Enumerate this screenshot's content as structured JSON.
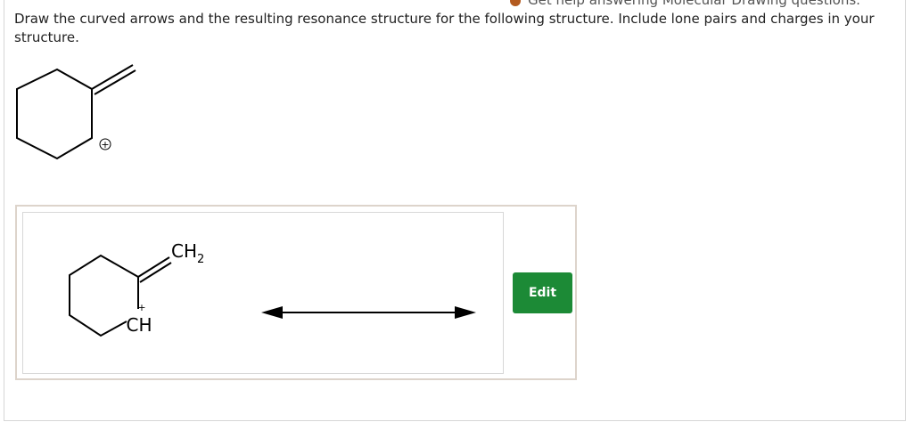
{
  "header": {
    "help_link": "Get help answering Molecular Drawing questions."
  },
  "question": {
    "prompt": "Draw the curved arrows and the resulting resonance structure for the following structure. Include lone pairs and charges in your structure."
  },
  "given_structure": {
    "charge_symbol": "+"
  },
  "answer": {
    "ch2_main": "CH",
    "ch2_sub": "2",
    "ch_label": "CH",
    "ch_charge": "+",
    "edit_label": "Edit"
  },
  "colors": {
    "edit_button": "#1c8a36",
    "box_border": "#ddd4cb",
    "help_icon": "#b35a1f"
  }
}
